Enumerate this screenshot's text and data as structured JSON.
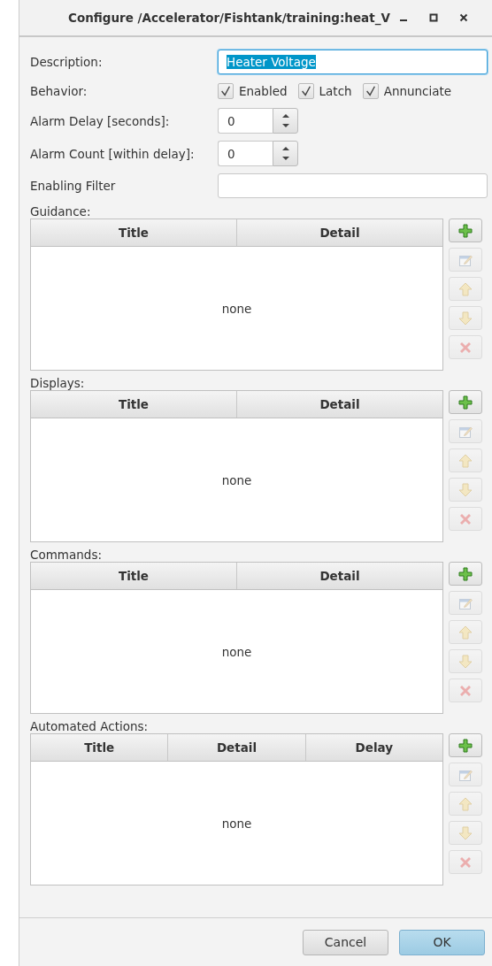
{
  "window": {
    "title": "Configure /Accelerator/Fishtank/training:heat_V",
    "controls": [
      {
        "kind": "minimize"
      },
      {
        "kind": "maximize"
      },
      {
        "kind": "close"
      }
    ]
  },
  "form": {
    "description": {
      "label": "Description:",
      "value": "Heater Voltage",
      "selected": true
    },
    "behavior": {
      "label": "Behavior:",
      "options": [
        {
          "label": "Enabled",
          "checked": true
        },
        {
          "label": "Latch",
          "checked": true
        },
        {
          "label": "Annunciate",
          "checked": true
        }
      ]
    },
    "alarm_delay": {
      "label": "Alarm Delay [seconds]:",
      "value": "0"
    },
    "alarm_count": {
      "label": "Alarm Count [within delay]:",
      "value": "0"
    },
    "enabling_filter": {
      "label": "Enabling Filter"
    }
  },
  "sections": [
    {
      "label": "Guidance:",
      "columns": [
        "Title",
        "Detail"
      ],
      "empty_text": "none",
      "buttons": [
        {
          "kind": "add",
          "disabled": false
        },
        {
          "kind": "edit",
          "disabled": true
        },
        {
          "kind": "up",
          "disabled": true
        },
        {
          "kind": "down",
          "disabled": true
        },
        {
          "kind": "delete",
          "disabled": true
        }
      ]
    },
    {
      "label": "Displays:",
      "columns": [
        "Title",
        "Detail"
      ],
      "empty_text": "none",
      "buttons": [
        {
          "kind": "add",
          "disabled": false
        },
        {
          "kind": "edit",
          "disabled": true
        },
        {
          "kind": "up",
          "disabled": true
        },
        {
          "kind": "down",
          "disabled": true
        },
        {
          "kind": "delete",
          "disabled": true
        }
      ]
    },
    {
      "label": "Commands:",
      "columns": [
        "Title",
        "Detail"
      ],
      "empty_text": "none",
      "buttons": [
        {
          "kind": "add",
          "disabled": false
        },
        {
          "kind": "edit",
          "disabled": true
        },
        {
          "kind": "up",
          "disabled": true
        },
        {
          "kind": "down",
          "disabled": true
        },
        {
          "kind": "delete",
          "disabled": true
        }
      ]
    },
    {
      "label": "Automated Actions:",
      "columns": [
        "Title",
        "Detail",
        "Delay"
      ],
      "empty_text": "none",
      "buttons": [
        {
          "kind": "add",
          "disabled": false
        },
        {
          "kind": "edit",
          "disabled": true
        },
        {
          "kind": "up",
          "disabled": true
        },
        {
          "kind": "down",
          "disabled": true
        },
        {
          "kind": "delete",
          "disabled": true
        }
      ]
    }
  ],
  "buttons": [
    {
      "label": "Cancel",
      "kind": "cancel"
    },
    {
      "label": "OK",
      "kind": "default"
    }
  ]
}
